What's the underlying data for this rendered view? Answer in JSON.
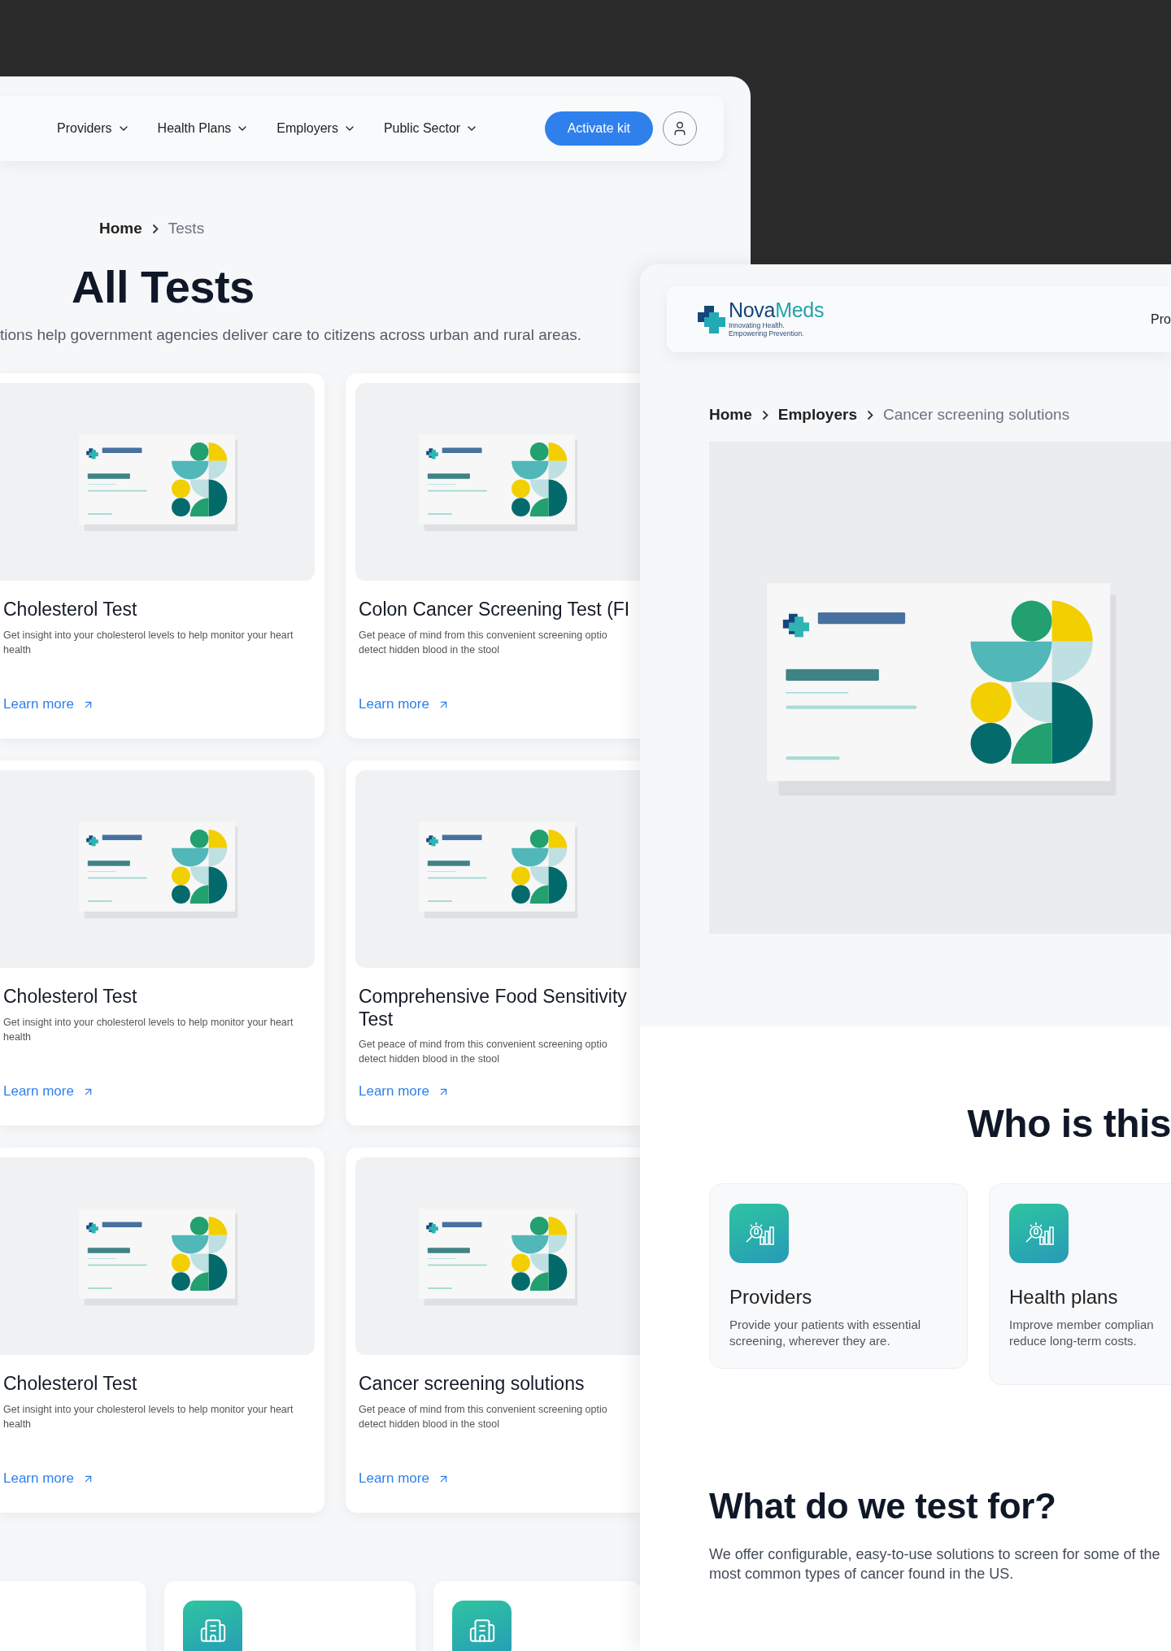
{
  "tests_page": {
    "nav": {
      "items": [
        {
          "label": "Providers",
          "dropdown": true
        },
        {
          "label": "Health Plans",
          "dropdown": true
        },
        {
          "label": "Employers",
          "dropdown": true
        },
        {
          "label": "Public Sector",
          "dropdown": true
        }
      ],
      "cta": "Activate kit"
    },
    "breadcrumb": [
      {
        "label": "Home",
        "current": false
      },
      {
        "label": "Tests",
        "current": true
      }
    ],
    "title": "All Tests",
    "subtitle": "tions help government agencies deliver care to citizens across urban and rural areas.",
    "cards": [
      {
        "title": "Cholesterol Test",
        "description": "Get insight into your cholesterol levels to help monitor your heart health",
        "link": "Learn more"
      },
      {
        "title": "Colon Cancer Screening Test (FI",
        "description": "Get peace of mind from this convenient screening optio detect hidden blood in the stool",
        "link": "Learn more"
      },
      {
        "title": "Cholesterol Test",
        "description": "Get insight into your cholesterol levels to help monitor your heart health",
        "link": "Learn more"
      },
      {
        "title": "Comprehensive Food Sensitivity Test",
        "description": "Get peace of mind from this convenient screening optio detect hidden blood in the stool",
        "link": "Learn more"
      },
      {
        "title": "Cholesterol Test",
        "description": "Get insight into your cholesterol levels to help monitor your heart health",
        "link": "Learn more"
      },
      {
        "title": "Cancer screening solutions",
        "description": "Get peace of mind from this convenient screening optio detect hidden blood in the stool",
        "link": "Learn more"
      }
    ],
    "bottom_cards": [
      {
        "kind": "blank"
      },
      {
        "kind": "icon"
      },
      {
        "kind": "icon"
      }
    ]
  },
  "solution_page": {
    "logo": {
      "wordmark": [
        "Nova",
        "Meds"
      ],
      "tagline": "Innovating Health. Empowering Prevention."
    },
    "nav": {
      "items": [
        {
          "label": "Pro",
          "dropdown": false
        }
      ]
    },
    "breadcrumb": [
      {
        "label": "Home",
        "current": false
      },
      {
        "label": "Employers",
        "current": false
      },
      {
        "label": "Cancer screening solutions",
        "current": true
      }
    ],
    "audience": {
      "title": "Who is this",
      "cards": [
        {
          "title": "Providers",
          "description": "Provide your patients with essential screening, wherever they are."
        },
        {
          "title": "Health plans",
          "description": "Improve member complian reduce long-term costs."
        }
      ]
    },
    "tests_section": {
      "title": "What do we test for?",
      "description": "We offer configurable, easy-to-use solutions to screen for some of the most common types of cancer found in the US."
    }
  }
}
